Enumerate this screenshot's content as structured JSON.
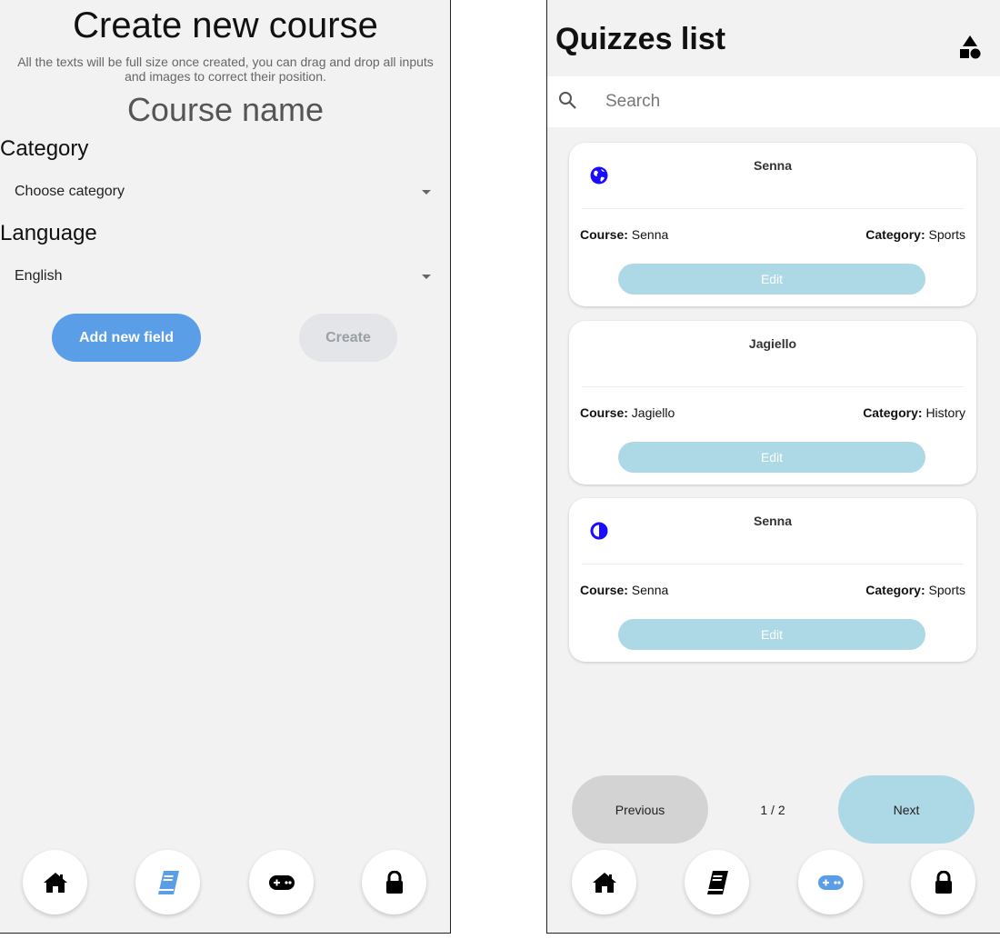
{
  "create_course": {
    "title": "Create new course",
    "subtitle": "All the texts will be full size once created, you can drag and drop all inputs and images to correct their position.",
    "course_name": "Course name",
    "category_label": "Category",
    "category_value": "Choose category",
    "language_label": "Language",
    "language_value": "English",
    "add_field_label": "Add new field",
    "create_label": "Create"
  },
  "quizzes": {
    "title": "Quizzes list",
    "search_placeholder": "Search",
    "course_prefix": "Course:",
    "category_prefix": "Category:",
    "edit_label": "Edit",
    "cards": [
      {
        "title": "Senna",
        "icon": "globe-icon",
        "course": "Senna",
        "category": "Sports"
      },
      {
        "title": "Jagiello",
        "icon": "",
        "course": "Jagiello",
        "category": "History"
      },
      {
        "title": "Senna",
        "icon": "half-circle-icon",
        "course": "Senna",
        "category": "Sports"
      }
    ],
    "prev_label": "Previous",
    "page": "1 / 2",
    "next_label": "Next"
  },
  "nav": {
    "items": [
      "home-icon",
      "book-icon",
      "gamepad-icon",
      "lock-icon"
    ],
    "left_active": "book-icon",
    "right_active": "gamepad-icon"
  },
  "colors": {
    "accent_blue": "#5b9ee8",
    "light_blue": "#add8e6",
    "icon_blue": "#1a0dff",
    "background": "#f2f2f2"
  }
}
